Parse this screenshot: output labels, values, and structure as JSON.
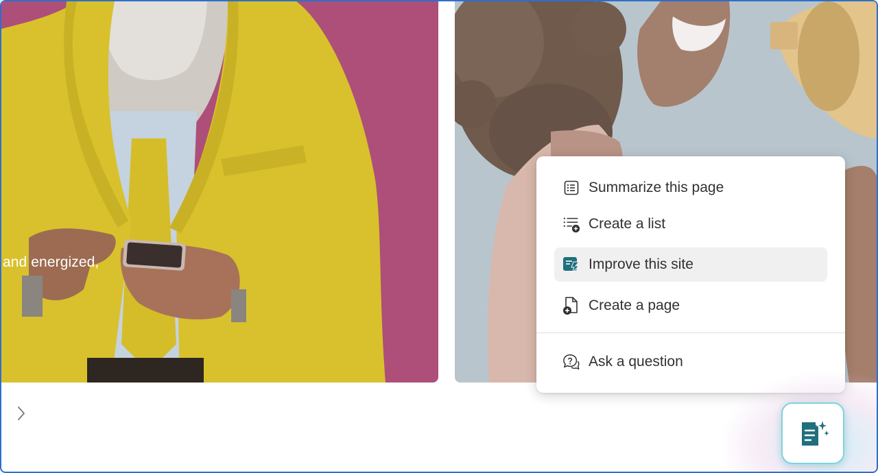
{
  "hero": {
    "caption": "and energized,"
  },
  "menu": {
    "items": [
      {
        "label": "Summarize this page",
        "icon": "summarize-icon"
      },
      {
        "label": "Create a list",
        "icon": "create-list-icon"
      },
      {
        "label": "Improve this site",
        "icon": "improve-site-icon",
        "active": true
      },
      {
        "label": "Create a page",
        "icon": "create-page-icon"
      },
      {
        "label": "Ask a question",
        "icon": "ask-question-icon"
      }
    ]
  },
  "colors": {
    "left_card_bg": "#ad4f79",
    "right_card_bg": "#b9c5cd",
    "jacket": "#d8c12c",
    "copilot_teal": "#1f6f7c",
    "frame_border": "#2f6fc9"
  },
  "icons": {
    "nav": "chevron-right-icon",
    "fab": "copilot-page-sparkle-icon"
  }
}
